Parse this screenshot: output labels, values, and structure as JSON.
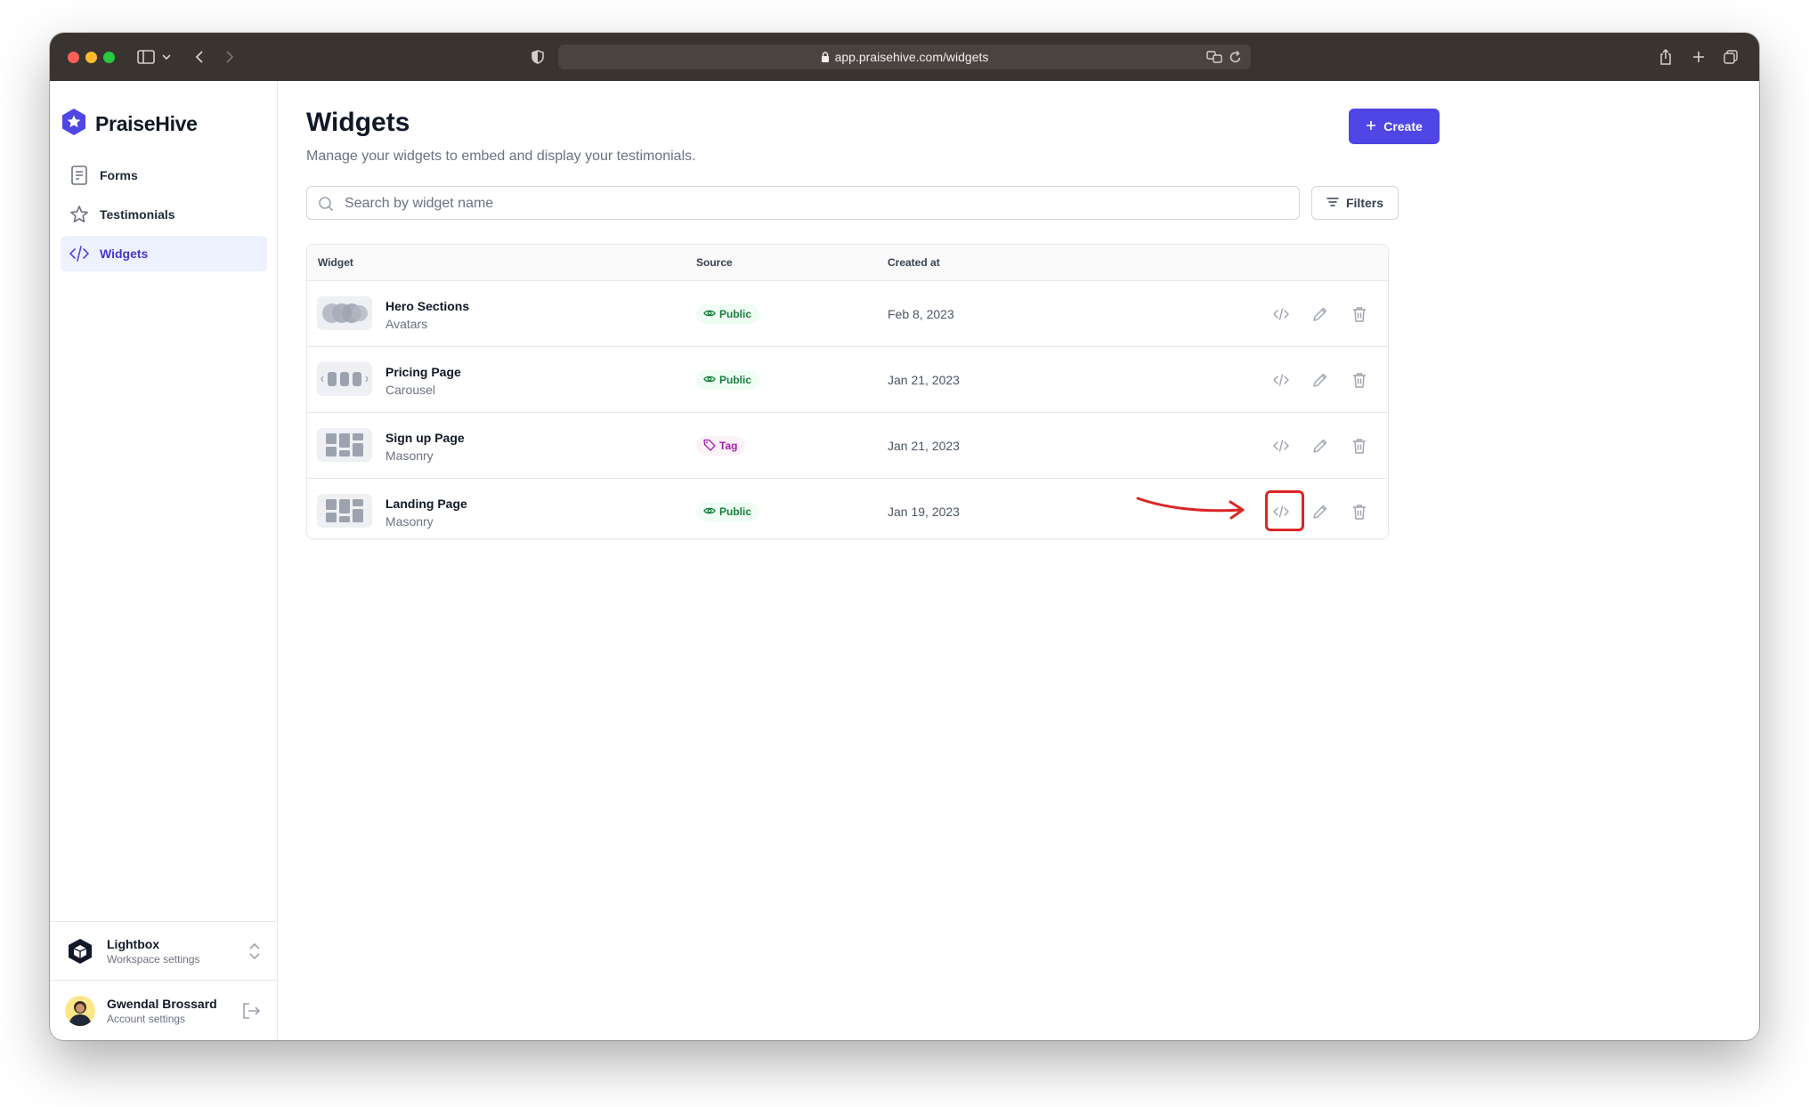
{
  "browser": {
    "url": "app.praisehive.com/widgets"
  },
  "sidebar": {
    "brand": "PraiseHive",
    "items": [
      {
        "label": "Forms",
        "icon": "form-icon"
      },
      {
        "label": "Testimonials",
        "icon": "star-icon"
      },
      {
        "label": "Widgets",
        "icon": "code-icon",
        "active": true
      }
    ],
    "workspace": {
      "name": "Lightbox",
      "sub": "Workspace settings"
    },
    "account": {
      "name": "Gwendal Brossard",
      "sub": "Account settings"
    }
  },
  "main": {
    "title": "Widgets",
    "subtitle": "Manage your widgets to embed and display your testimonials.",
    "create_label": "Create",
    "search_placeholder": "Search by widget name",
    "filters_label": "Filters",
    "columns": [
      "Widget",
      "Source",
      "Created at"
    ],
    "rows": [
      {
        "name": "Hero Sections",
        "type": "Avatars",
        "source": "Public",
        "created": "Feb 8, 2023"
      },
      {
        "name": "Pricing Page",
        "type": "Carousel",
        "source": "Public",
        "created": "Jan 21, 2023"
      },
      {
        "name": "Sign up Page",
        "type": "Masonry",
        "source": "Tag",
        "created": "Jan 21, 2023"
      },
      {
        "name": "Landing Page",
        "type": "Masonry",
        "source": "Public",
        "created": "Jan 19, 2023",
        "embed_highlighted": true
      }
    ]
  },
  "colors": {
    "accent": "#4f46e5",
    "public_badge": "#15803d",
    "tag_badge": "#a21caf",
    "annotation": "#dc2626"
  }
}
